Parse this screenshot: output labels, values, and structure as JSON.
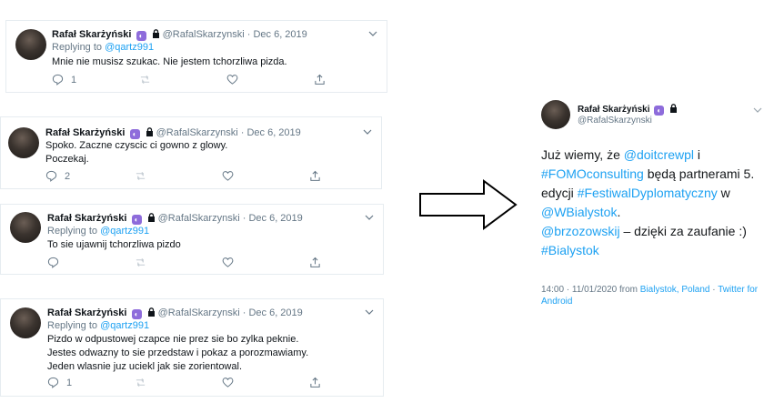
{
  "author": {
    "name": "Rafał Skarżyński",
    "handle": "@RafalSkarzynski"
  },
  "tweets": [
    {
      "date": "Dec 6, 2019",
      "replying_prefix": "Replying to",
      "replying_to": "@qartz991",
      "lines": [
        "Mnie nie musisz szukac. Nie jestem tchorzliwa pizda."
      ],
      "reply_count": "1"
    },
    {
      "date": "Dec 6, 2019",
      "replying_prefix": "",
      "replying_to": "",
      "lines": [
        "Spoko. Zaczne czyscic ci gowno z glowy.",
        "Poczekaj."
      ],
      "reply_count": "2"
    },
    {
      "date": "Dec 6, 2019",
      "replying_prefix": "Replying to",
      "replying_to": "@qartz991",
      "lines": [
        "To sie ujawnij tchorzliwa pizdo"
      ],
      "reply_count": ""
    },
    {
      "date": "Dec 6, 2019",
      "replying_prefix": "Replying to",
      "replying_to": "@qartz991",
      "lines": [
        "Pizdo w odpustowej czapce nie prez sie bo zylka peknie.",
        "Jestes odwazny to sie przedstaw i pokaz a porozmawiamy.",
        "Jeden wlasnie juz uciekl jak sie zorientowal."
      ],
      "reply_count": "1"
    }
  ],
  "main_tweet": {
    "name": "Rafał Skarżyński",
    "handle": "@RafalSkarzynski",
    "l1_a": "Już wiemy, że ",
    "l1_mention": "@doitcrewpl",
    "l1_b": " i",
    "l2_tag": "#FOMOconsulting",
    "l2_b": " będą partnerami 5.",
    "l3_a": "edycji ",
    "l3_tag": "#FestiwalDyplomatyczny",
    "l3_b": " w",
    "l4_tag": "@WBialystok",
    "l4_b": ".",
    "l5_mention": "@brzozowskij",
    "l5_b": " – dzięki za zaufanie :)",
    "l6_tag": "#Bialystok",
    "meta_time": "14:00 · 11/01/2020 from ",
    "meta_place": "Bialystok, Poland",
    "meta_sep": " · ",
    "meta_source": "Twitter for Android"
  },
  "icons": {
    "verified_badge": "purple-badge-icon",
    "lock": "lock-icon",
    "caret": "chevron-down-icon",
    "reply": "reply-icon",
    "retweet": "retweet-icon",
    "like": "heart-icon",
    "share": "share-icon",
    "arrow": "right-arrow-icon"
  },
  "colors": {
    "link": "#1da1f2",
    "muted": "#657786",
    "badge": "#8e6cdb",
    "border": "#e6ecf0"
  }
}
